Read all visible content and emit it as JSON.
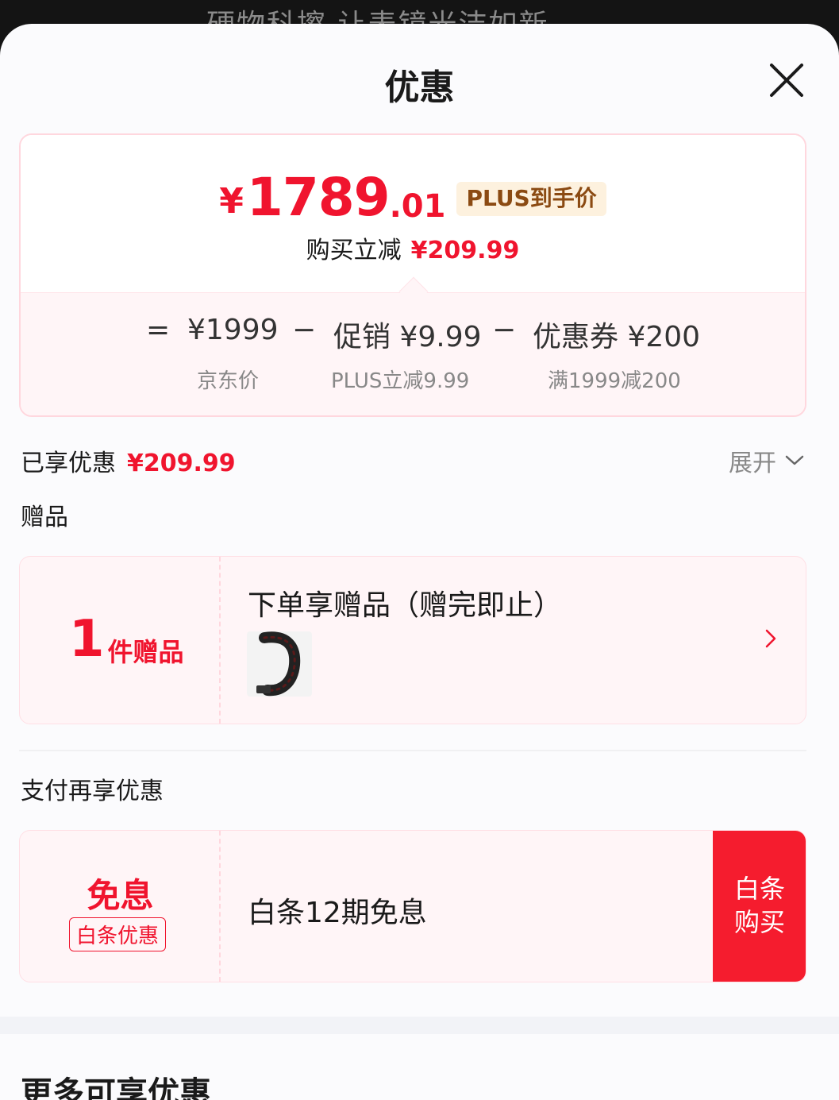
{
  "background_strip": {
    "text": "硬物科擦 让表镜光洁如新"
  },
  "sheet": {
    "title": "优惠"
  },
  "price_card": {
    "currency": "¥",
    "final_int": "1789",
    "final_dec": ".01",
    "plus_badge": "PLUS到手价",
    "save_label": "购买立减",
    "save_amount": "¥209.99",
    "equals": "=",
    "minus": "−",
    "items": [
      {
        "value": "¥1999",
        "sub": "京东价"
      },
      {
        "value": "促销 ¥9.99",
        "sub": "PLUS立减9.99"
      },
      {
        "value": "优惠券 ¥200",
        "sub": "满1999减200"
      }
    ]
  },
  "enjoyed": {
    "label": "已享优惠",
    "amount": "¥209.99",
    "expand_label": "展开"
  },
  "gift": {
    "section_label": "赠品",
    "count": "1",
    "count_unit": "件赠品",
    "title": "下单享赠品（赠完即止）"
  },
  "payment": {
    "section_label": "支付再享优惠",
    "big": "免息",
    "tag": "白条优惠",
    "text": "白条12期免息",
    "button_line1": "白条",
    "button_line2": "购买"
  },
  "more": {
    "title": "更多可享优惠"
  },
  "colors": {
    "accent": "#f0142e",
    "button": "#f51c2e",
    "badge_bg": "#fdf1de",
    "badge_text": "#8b4a12"
  }
}
